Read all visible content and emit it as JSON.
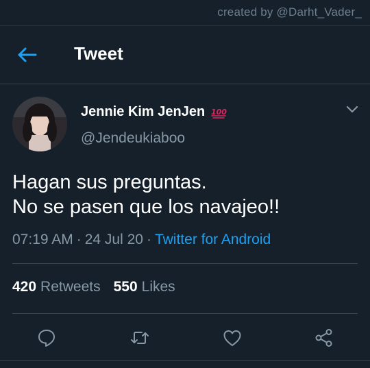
{
  "watermark": "created by @Darht_Vader_",
  "header": {
    "title": "Tweet",
    "back_icon": "arrow-left-icon"
  },
  "tweet": {
    "author": {
      "name": "Jennie Kim JenJen",
      "name_emoji": "💯",
      "handle": "@Jendeukiaboo"
    },
    "text_lines": [
      "Hagan sus preguntas.",
      "No se pasen que los navajeo!!"
    ],
    "time": "07:19 AM",
    "date": "24 Jul 20",
    "separator": "·",
    "source": "Twitter for Android",
    "stats": {
      "retweets_count": "420",
      "retweets_label": "Retweets",
      "likes_count": "550",
      "likes_label": "Likes"
    }
  },
  "actions": [
    {
      "name": "reply-icon"
    },
    {
      "name": "retweet-icon"
    },
    {
      "name": "like-icon"
    },
    {
      "name": "share-icon"
    }
  ],
  "colors": {
    "background": "#15202b",
    "accent": "#1da1f2",
    "secondary_text": "#8899a6",
    "divider": "#38444d",
    "emoji_red": "#e0245e"
  }
}
